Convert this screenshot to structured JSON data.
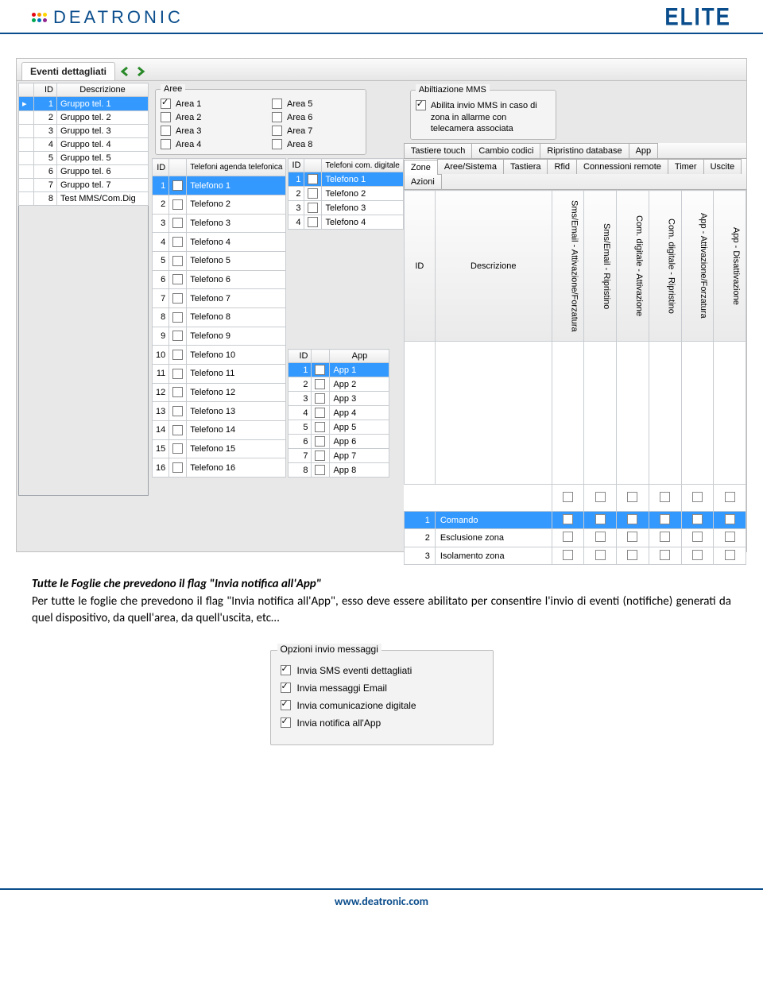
{
  "logos": {
    "deatronic": "DEATRONIC",
    "elite": "ELITE"
  },
  "top_tab": "Eventi dettagliati",
  "groups": {
    "headers": [
      "",
      "ID",
      "Descrizione"
    ],
    "rows": [
      {
        "ind": "▸",
        "id": "1",
        "desc": "Gruppo tel. 1",
        "sel": true
      },
      {
        "ind": "",
        "id": "2",
        "desc": "Gruppo tel. 2"
      },
      {
        "ind": "",
        "id": "3",
        "desc": "Gruppo tel. 3"
      },
      {
        "ind": "",
        "id": "4",
        "desc": "Gruppo tel. 4"
      },
      {
        "ind": "",
        "id": "5",
        "desc": "Gruppo tel. 5"
      },
      {
        "ind": "",
        "id": "6",
        "desc": "Gruppo tel. 6"
      },
      {
        "ind": "",
        "id": "7",
        "desc": "Gruppo tel. 7"
      },
      {
        "ind": "",
        "id": "8",
        "desc": "Test MMS/Com.Dig"
      }
    ]
  },
  "areas": {
    "legend": "Aree",
    "items": [
      {
        "label": "Area 1",
        "checked": true
      },
      {
        "label": "Area 2"
      },
      {
        "label": "Area 3"
      },
      {
        "label": "Area 4"
      },
      {
        "label": "Area 5"
      },
      {
        "label": "Area 6"
      },
      {
        "label": "Area 7"
      },
      {
        "label": "Area 8"
      }
    ]
  },
  "mms": {
    "legend": "Abiltiazione MMS",
    "checkbox_label": "Abilita invio MMS in caso di zona in allarme con telecamera associata",
    "checked": true
  },
  "tel_agenda": {
    "headers": [
      "ID",
      "",
      "Telefoni agenda telefonica"
    ],
    "rows": [
      {
        "id": "1",
        "desc": "Telefono 1",
        "sel": true
      },
      {
        "id": "2",
        "desc": "Telefono 2"
      },
      {
        "id": "3",
        "desc": "Telefono 3"
      },
      {
        "id": "4",
        "desc": "Telefono 4"
      },
      {
        "id": "5",
        "desc": "Telefono 5"
      },
      {
        "id": "6",
        "desc": "Telefono 6"
      },
      {
        "id": "7",
        "desc": "Telefono 7"
      },
      {
        "id": "8",
        "desc": "Telefono 8"
      },
      {
        "id": "9",
        "desc": "Telefono 9"
      },
      {
        "id": "10",
        "desc": "Telefono 10"
      },
      {
        "id": "11",
        "desc": "Telefono 11"
      },
      {
        "id": "12",
        "desc": "Telefono 12"
      },
      {
        "id": "13",
        "desc": "Telefono 13"
      },
      {
        "id": "14",
        "desc": "Telefono 14"
      },
      {
        "id": "15",
        "desc": "Telefono 15"
      },
      {
        "id": "16",
        "desc": "Telefono 16"
      }
    ]
  },
  "tel_com": {
    "headers": [
      "ID",
      "",
      "Telefoni com. digitale"
    ],
    "rows": [
      {
        "id": "1",
        "desc": "Telefono 1",
        "sel": true
      },
      {
        "id": "2",
        "desc": "Telefono 2"
      },
      {
        "id": "3",
        "desc": "Telefono 3"
      },
      {
        "id": "4",
        "desc": "Telefono 4"
      }
    ]
  },
  "apps": {
    "headers": [
      "ID",
      "",
      "App"
    ],
    "rows": [
      {
        "id": "1",
        "desc": "App 1",
        "sel": true
      },
      {
        "id": "2",
        "desc": "App 2"
      },
      {
        "id": "3",
        "desc": "App 3"
      },
      {
        "id": "4",
        "desc": "App 4"
      },
      {
        "id": "5",
        "desc": "App 5"
      },
      {
        "id": "6",
        "desc": "App 6"
      },
      {
        "id": "7",
        "desc": "App 7"
      },
      {
        "id": "8",
        "desc": "App 8"
      }
    ]
  },
  "tabs_row1": [
    "Tastiere touch",
    "Cambio codici",
    "Ripristino database",
    "App"
  ],
  "tabs_row2": [
    "Zone",
    "Aree/Sistema",
    "Tastiera",
    "Rfid",
    "Connessioni remote",
    "Timer",
    "Uscite",
    "Azioni"
  ],
  "tabs_active": "Zone",
  "zone": {
    "id_hdr": "ID",
    "desc_hdr": "Descrizione",
    "vcols": [
      "Sms/Email - Attivazione/Forzatura",
      "Sms/Email - Ripristino",
      "Com. digitale - Attivazione",
      "Com. digitale - Ripristino",
      "App - Attivazione/Forzatura",
      "App - Disattivazione"
    ],
    "rows": [
      {
        "id": "1",
        "desc": "Comando",
        "sel": true
      },
      {
        "id": "2",
        "desc": "Esclusione zona"
      },
      {
        "id": "3",
        "desc": "Isolamento zona"
      }
    ]
  },
  "body": {
    "title": "Tutte le Foglie che prevedono il flag \"Invia notifica all'App\"",
    "text": "Per tutte le foglie che prevedono il flag \"Invia notifica all'App\", esso deve essere abilitato per consentire l'invio di eventi (notifiche) generati da quel dispositivo, da quell'area, da quell'uscita, etc…"
  },
  "options": {
    "legend": "Opzioni invio messaggi",
    "items": [
      {
        "label": "Invia SMS eventi dettagliati",
        "checked": true
      },
      {
        "label": "Invia messaggi Email",
        "checked": true
      },
      {
        "label": "Invia comunicazione digitale",
        "checked": true
      },
      {
        "label": "Invia notifica all'App",
        "checked": true
      }
    ]
  },
  "footer": "www.deatronic.com"
}
